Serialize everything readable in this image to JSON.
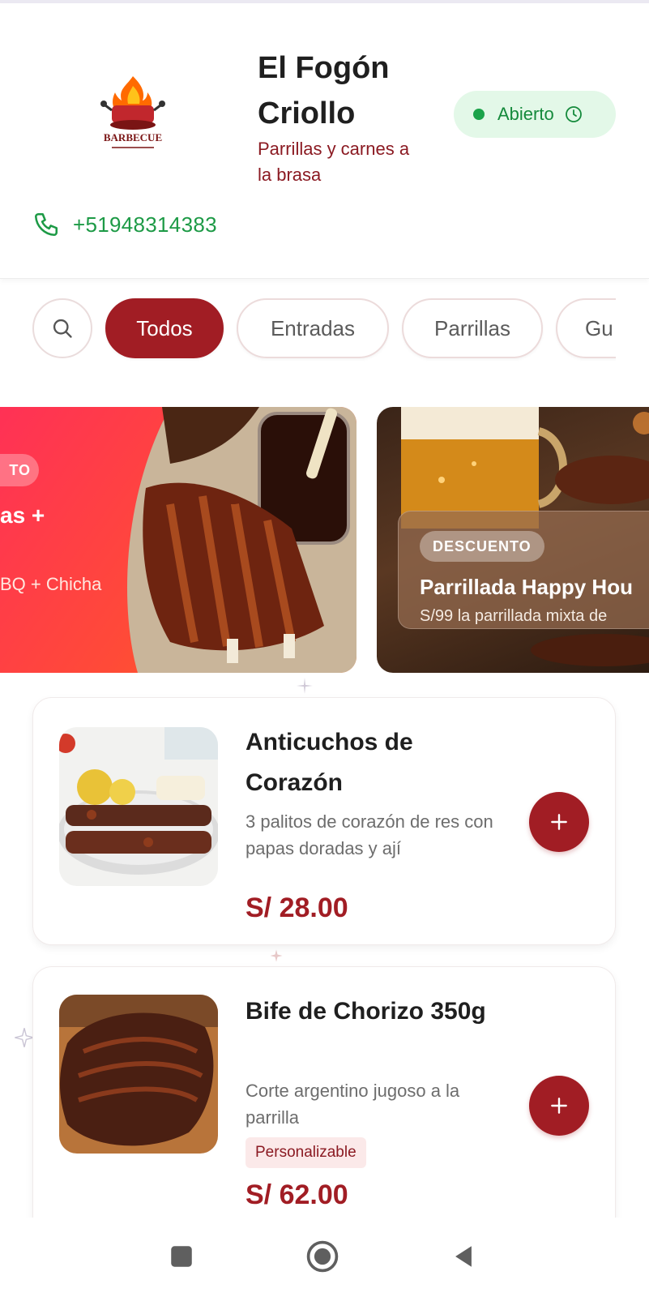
{
  "restaurant": {
    "name": "El Fogón Criollo",
    "tagline": "Parrillas y carnes a la brasa",
    "status": "Abierto",
    "phone": "+51948314383",
    "logo_text": "BARBECUE"
  },
  "categories": [
    {
      "label": "Todos",
      "active": true
    },
    {
      "label": "Entradas",
      "active": false
    },
    {
      "label": "Parrillas",
      "active": false
    },
    {
      "label": "Gu",
      "active": false
    }
  ],
  "banners": [
    {
      "tag": "TO",
      "title": "as +",
      "subtitle": "BQ + Chicha"
    },
    {
      "tag": "DESCUENTO",
      "title": "Parrillada Happy Hou",
      "subtitle": "S/99 la parrillada mixta de"
    }
  ],
  "dishes": [
    {
      "name": "Anticuchos de Corazón",
      "description": "3 palitos de corazón de res con papas doradas y ají",
      "price": "S/ 28.00",
      "badge": ""
    },
    {
      "name": "Bife de Chorizo 350g",
      "description": "Corte argentino jugoso a la parrilla",
      "price": "S/ 62.00",
      "badge": "Personalizable"
    }
  ],
  "colors": {
    "primary": "#a11d24",
    "status_bg": "#e3f8e8",
    "status_text": "#158a3c",
    "phone": "#1d9a46",
    "banner_gradient_start": "#ff2f58",
    "banner_gradient_end": "#ff6a18"
  },
  "icons": {
    "search": "search-icon",
    "phone": "phone-icon",
    "clock": "clock-icon",
    "add": "plus-icon",
    "nav_recents": "square-icon",
    "nav_home": "circle-icon",
    "nav_back": "triangle-back-icon"
  }
}
